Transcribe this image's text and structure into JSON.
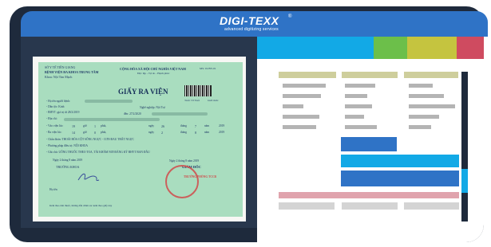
{
  "brand": {
    "name": "DIGI-TEXX",
    "registered": "®",
    "tagline": "advanced digitizing services",
    "colors": {
      "frame": "#1e2a3c",
      "header": "#2f73c6",
      "cyan": "#12a9e6",
      "green": "#6cbf4a",
      "olive": "#c5c43f",
      "red": "#cf4b60"
    }
  },
  "document": {
    "org_line1": "SỞ Y TẾ TIỀN GIANG",
    "org_line2": "BỆNH VIỆN ĐA KHOA TRUNG TÂM",
    "dept": "Khoa: Nội Tim Mạch",
    "country_line1": "CỘNG HÒA XÃ HỘI CHỦ NGHĨA VIỆT NAM",
    "country_line2": "Độc lập - Tự do - Hạnh phúc",
    "form_no": "MS: 01/BV-01",
    "title": "GIẤY RA VIỆN",
    "age_label": "Tuổi: 53 Tuổi",
    "gender_label": "Giới tính:",
    "patient_name_label": "- Họ tên người bệnh:",
    "ethnicity_label": "- Dân tộc: Kinh",
    "occupation_label": "Nghề nghiệp: Nội Trợ",
    "insurance_label": "- BHYT: giá trị từ 28/2/2019",
    "insurance_to": "đến: 27/2/2020",
    "address_label": "- Địa chỉ:",
    "admit_label": "- Vào viện lúc:",
    "admit_hour": "19",
    "admit_unit_hour": "giờ",
    "admit_min": "1",
    "admit_unit_min": "phút,",
    "admit_day_label": "ngày",
    "admit_day": "26",
    "admit_month_label": "tháng",
    "admit_month": "7",
    "admit_year_label": "năm",
    "admit_year": "2019",
    "discharge_label": "- Ra viện lúc:",
    "discharge_hour": "14",
    "discharge_min": "0",
    "discharge_day": "2",
    "discharge_month": "8",
    "discharge_year": "2019",
    "diagnosis": "- Chẩn đoán: THOÁI HÓA CỘT SỐNG NGỰC - CƠN ĐAU THẮT NGỰC",
    "treatment": "- Phương pháp điều trị:   NỘI KHOA",
    "note": "- Ghi chú: UỐNG THUỐC THEO TOA, TÁI KHÁM NƠI ĐĂNG KÝ BHYT BAN ĐẦU",
    "date_left": "Ngày 2 tháng 8 năm 2019",
    "date_right": "Ngày 2 tháng 8 năm 2019",
    "head_dept": "TRƯỞNG KHOA",
    "director": "GIÁM ĐỐC",
    "stamp_text": "TRƯỞNG PHÒNG TCCB",
    "signer_label": "Họ tên",
    "footer": "Kèm theo đơn thuốc, hướng dẫn chăm sóc kèm theo giấy này"
  }
}
